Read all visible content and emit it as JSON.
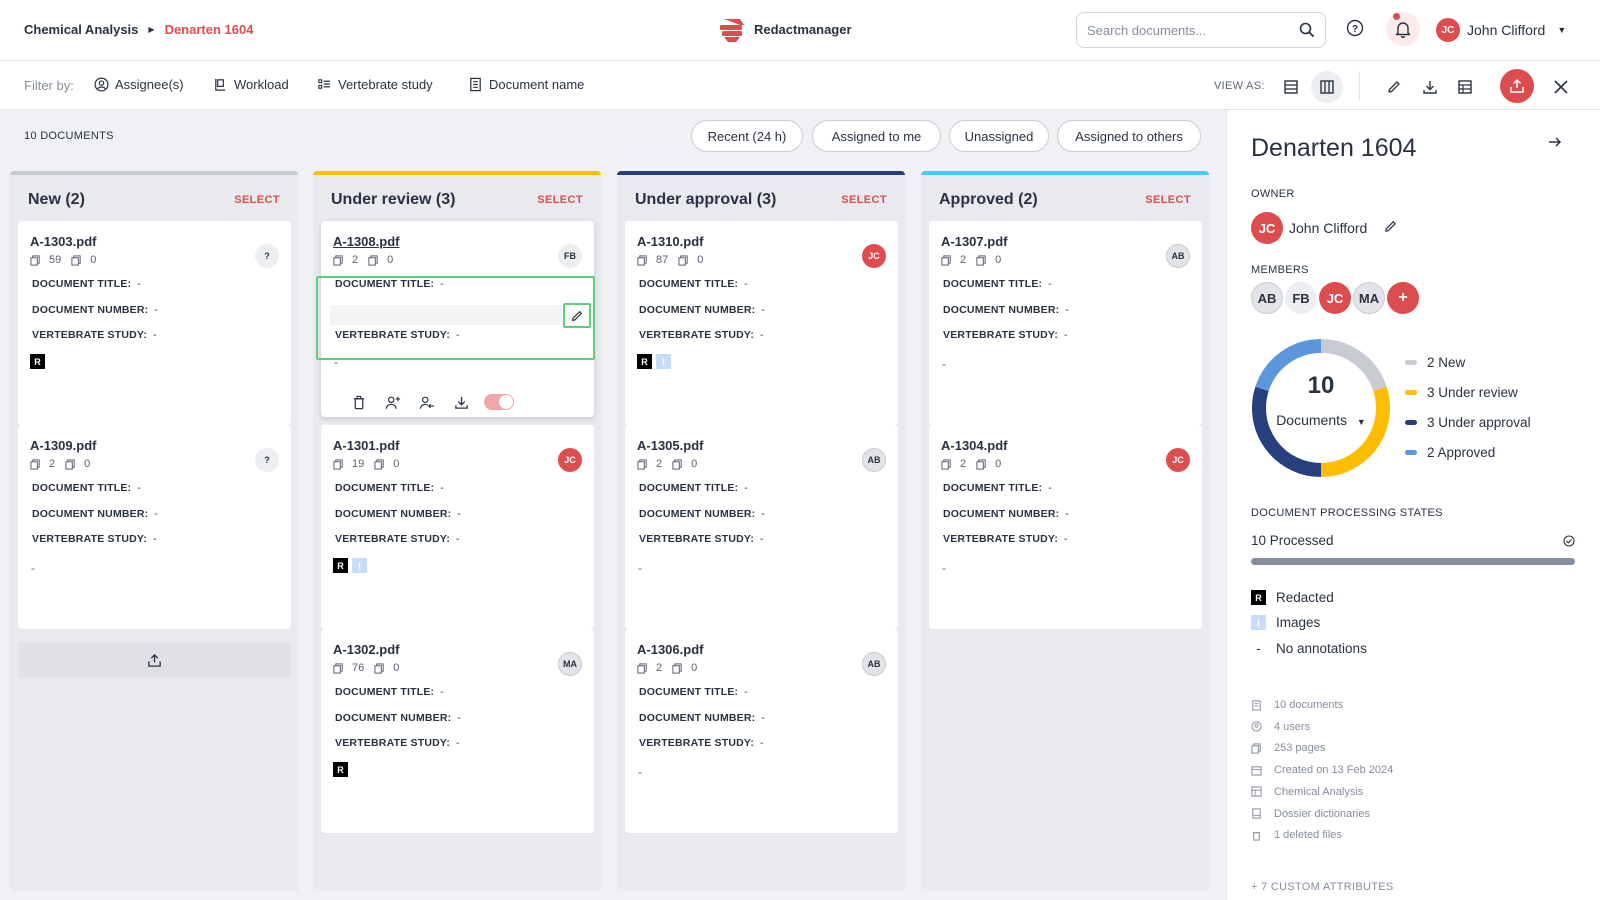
{
  "breadcrumb": {
    "parent": "Chemical Analysis",
    "current": "Denarten 1604"
  },
  "app": {
    "name": "Redactmanager"
  },
  "search": {
    "placeholder": "Search documents..."
  },
  "user": {
    "initials": "JC",
    "name": "John Clifford"
  },
  "filters": {
    "label": "Filter by:",
    "items": [
      "Assignee(s)",
      "Workload",
      "Vertebrate study",
      "Document name"
    ]
  },
  "view_as": "VIEW AS:",
  "documents_count": "10 DOCUMENTS",
  "quick_filters": [
    "Recent (24 h)",
    "Assigned to me",
    "Unassigned",
    "Assigned to others"
  ],
  "select_label": "SELECT",
  "attr_labels": {
    "title": "DOCUMENT TITLE:",
    "number": "DOCUMENT NUMBER:",
    "study": "VERTEBRATE STUDY:"
  },
  "attr_value": "-",
  "columns": [
    {
      "title": "New (2)",
      "color": "#c8cbd2",
      "cards": [
        {
          "name": "A-1303.pdf",
          "pages": "59",
          "annotations": "0",
          "assignee": "?",
          "badges": [
            "R"
          ]
        },
        {
          "name": "A-1309.pdf",
          "pages": "2",
          "annotations": "0",
          "assignee": "?",
          "badges": []
        }
      ]
    },
    {
      "title": "Under review (3)",
      "color": "#fdbd00",
      "cards": [
        {
          "name": "A-1308.pdf",
          "pages": "2",
          "annotations": "0",
          "assignee": "FB",
          "badges": []
        },
        {
          "name": "A-1301.pdf",
          "pages": "19",
          "annotations": "0",
          "assignee": "JC",
          "badges": [
            "R",
            "I"
          ]
        },
        {
          "name": "A-1302.pdf",
          "pages": "76",
          "annotations": "0",
          "assignee": "MA",
          "badges": [
            "R"
          ]
        }
      ]
    },
    {
      "title": "Under approval (3)",
      "color": "#283f7e",
      "cards": [
        {
          "name": "A-1310.pdf",
          "pages": "87",
          "annotations": "0",
          "assignee": "JC",
          "badges": [
            "R",
            "I"
          ]
        },
        {
          "name": "A-1305.pdf",
          "pages": "2",
          "annotations": "0",
          "assignee": "AB",
          "badges": []
        },
        {
          "name": "A-1306.pdf",
          "pages": "2",
          "annotations": "0",
          "assignee": "AB",
          "badges": []
        }
      ]
    },
    {
      "title": "Approved (2)",
      "color": "#48c9f7",
      "cards": [
        {
          "name": "A-1307.pdf",
          "pages": "2",
          "annotations": "0",
          "assignee": "AB",
          "badges": []
        },
        {
          "name": "A-1304.pdf",
          "pages": "2",
          "annotations": "0",
          "assignee": "JC",
          "badges": []
        }
      ]
    }
  ],
  "panel": {
    "title": "Denarten 1604",
    "owner_label": "OWNER",
    "owner": {
      "initials": "JC",
      "name": "John Clifford"
    },
    "members_label": "MEMBERS",
    "members": [
      "AB",
      "FB",
      "JC",
      "MA"
    ],
    "add_member": "+",
    "donut": {
      "total": "10",
      "label": "Documents"
    },
    "states": [
      {
        "label": "2 New",
        "value": 2,
        "color": "#c8cbd2"
      },
      {
        "label": "3 Under review",
        "value": 3,
        "color": "#fdbd00"
      },
      {
        "label": "3 Under approval",
        "value": 3,
        "color": "#283f7e"
      },
      {
        "label": "2 Approved",
        "value": 2,
        "color": "#5b97db"
      }
    ],
    "processing_label": "DOCUMENT PROCESSING STATES",
    "processed": "10 Processed",
    "processed_fraction": 1.0,
    "legend": [
      {
        "badge": "R",
        "label": "Redacted"
      },
      {
        "badge": "I",
        "label": "Images"
      },
      {
        "badge": "-",
        "label": "No annotations"
      }
    ],
    "stats": [
      "10 documents",
      "4 users",
      "253 pages",
      "Created on 13 Feb 2024",
      "Chemical Analysis",
      "Dossier dictionaries",
      "1 deleted files"
    ],
    "custom_attributes": "+ 7 CUSTOM ATTRIBUTES"
  },
  "colors": {
    "accent": "#dd4d50",
    "highlight": "#5ad07d"
  }
}
